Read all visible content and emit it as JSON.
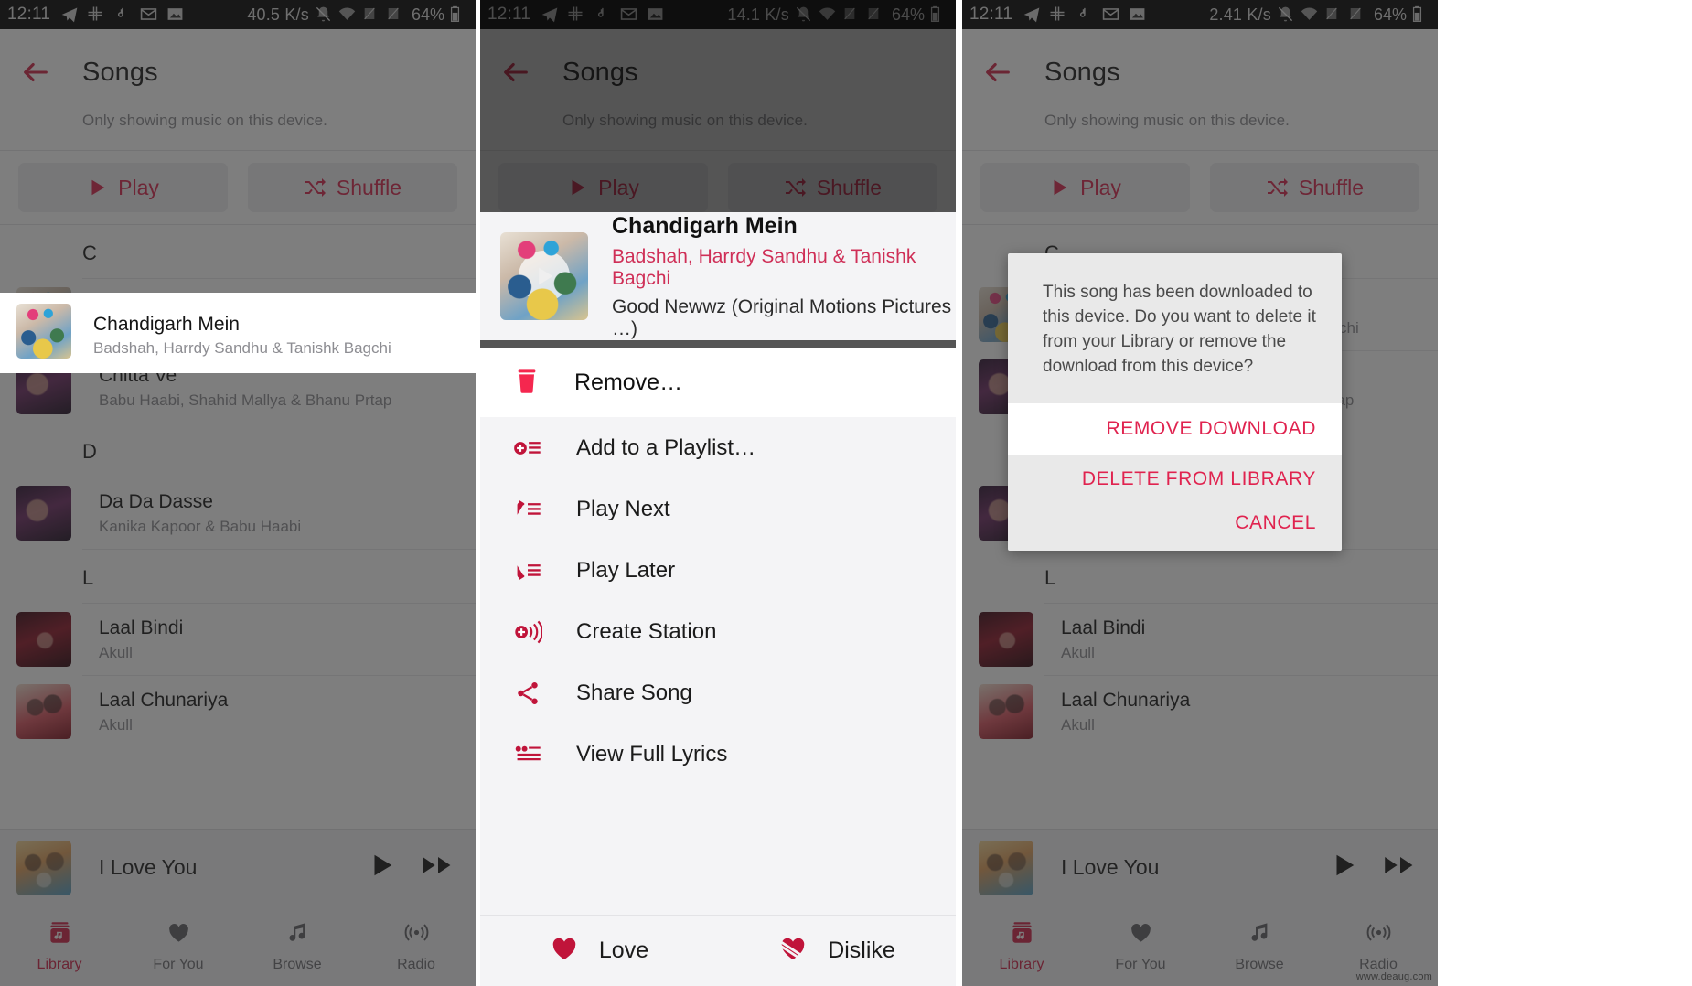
{
  "panels": [
    {
      "id": "songs-list",
      "status": {
        "time": "12:11",
        "net_speed": "40.5 K/s",
        "battery": "64%"
      },
      "title": "Songs",
      "subtitle": "Only showing music on this device.",
      "play_label": "Play",
      "shuffle_label": "Shuffle"
    },
    {
      "id": "context-menu",
      "status": {
        "time": "12:11",
        "net_speed": "14.1 K/s",
        "battery": "64%"
      },
      "title": "Songs",
      "subtitle": "Only showing music on this device.",
      "play_label": "Play",
      "shuffle_label": "Shuffle"
    },
    {
      "id": "remove-dialog",
      "status": {
        "time": "12:11",
        "net_speed": "2.41 K/s",
        "battery": "64%"
      },
      "title": "Songs",
      "subtitle": "Only showing music on this device.",
      "play_label": "Play",
      "shuffle_label": "Shuffle"
    }
  ],
  "sections": [
    {
      "letter": "C"
    },
    {
      "letter": "D"
    },
    {
      "letter": "L"
    }
  ],
  "songs": [
    {
      "title": "Chandigarh Mein",
      "artist": "Badshah, Harrdy Sandhu & Tanishk Bagchi",
      "art": "art-goodnewwz"
    },
    {
      "title": "Chitta Ve",
      "artist": "Babu Haabi, Shahid Mallya & Bhanu Prtap",
      "art": "art-chitta"
    },
    {
      "title": "Da Da Dasse",
      "artist": "Kanika Kapoor & Babu Haabi",
      "art": "art-chitta"
    },
    {
      "title": "Laal Bindi",
      "artist": "Akull",
      "art": "art-laalbindi"
    },
    {
      "title": "Laal Chunariya",
      "artist": "Akull",
      "art": "art-chunariya"
    }
  ],
  "mini_player": {
    "title": "I Love You",
    "art": "art-iloveyou"
  },
  "bottom_nav": [
    {
      "label": "Library",
      "icon": "library-icon",
      "active": true
    },
    {
      "label": "For You",
      "icon": "heart-icon",
      "active": false
    },
    {
      "label": "Browse",
      "icon": "music-note-icon",
      "active": false
    },
    {
      "label": "Radio",
      "icon": "radio-waves-icon",
      "active": false
    }
  ],
  "context_menu": {
    "song_title": "Chandigarh Mein",
    "song_artist": "Badshah, Harrdy Sandhu & Tanishk Bagchi",
    "song_album": "Good Newwz (Original Motions Pictures …)",
    "remove_label": "Remove…",
    "items": [
      {
        "label": "Add to a Playlist…",
        "icon": "add-to-playlist-icon"
      },
      {
        "label": "Play Next",
        "icon": "play-next-icon"
      },
      {
        "label": "Play Later",
        "icon": "play-later-icon"
      },
      {
        "label": "Create Station",
        "icon": "create-station-icon"
      },
      {
        "label": "Share Song",
        "icon": "share-icon"
      },
      {
        "label": "View Full Lyrics",
        "icon": "lyrics-icon"
      }
    ],
    "love_label": "Love",
    "dislike_label": "Dislike"
  },
  "dialog": {
    "message": "This song has been downloaded to this device. Do you want to delete it from your Library or remove the download from this device?",
    "buttons": [
      {
        "label": "REMOVE DOWNLOAD",
        "primary": true
      },
      {
        "label": "DELETE FROM LIBRARY",
        "primary": false
      },
      {
        "label": "CANCEL",
        "primary": false
      }
    ]
  },
  "colors": {
    "accent": "#d7244c",
    "accent_dark": "#a4173a",
    "status_bar": "#000000",
    "panel_bg": "#ffffff"
  },
  "watermark": "www.deaug.com"
}
